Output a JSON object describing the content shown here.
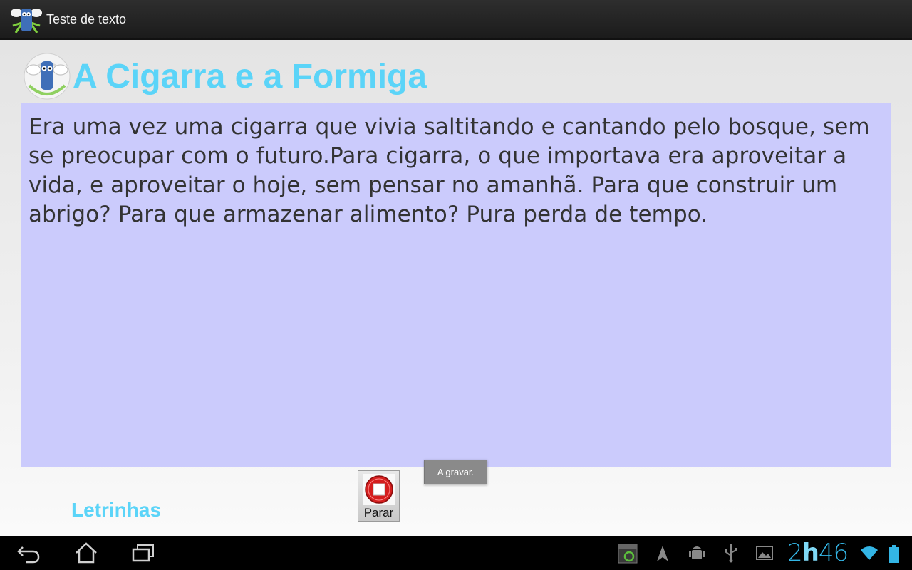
{
  "actionbar": {
    "app_title": "Teste de texto",
    "app_icon": "mascot-icon"
  },
  "story": {
    "title": "A Cigarra e a Formiga",
    "text": "Era uma vez uma cigarra que vivia saltitando e cantando pelo bosque, sem se preocupar com o futuro.Para cigarra, o que importava era aproveitar a vida, e aproveitar o hoje, sem pensar no amanhã. Para que construir um abrigo? Para que armazenar alimento? Pura perda de tempo."
  },
  "footer": {
    "brand": "Letrinhas",
    "stop_button_label": "Parar",
    "toast": "A gravar."
  },
  "systembar": {
    "time_hour": "2",
    "time_h": "h",
    "time_min": "46",
    "icons": [
      "back-icon",
      "home-icon",
      "recent-apps-icon",
      "screenshot-icon",
      "navigation-icon",
      "android-debug-icon",
      "usb-icon",
      "gallery-icon",
      "wifi-icon",
      "battery-icon"
    ]
  },
  "colors": {
    "accent": "#5bd4f8",
    "story_bg": "#cbcbfc",
    "clock": "#33b5e5"
  }
}
